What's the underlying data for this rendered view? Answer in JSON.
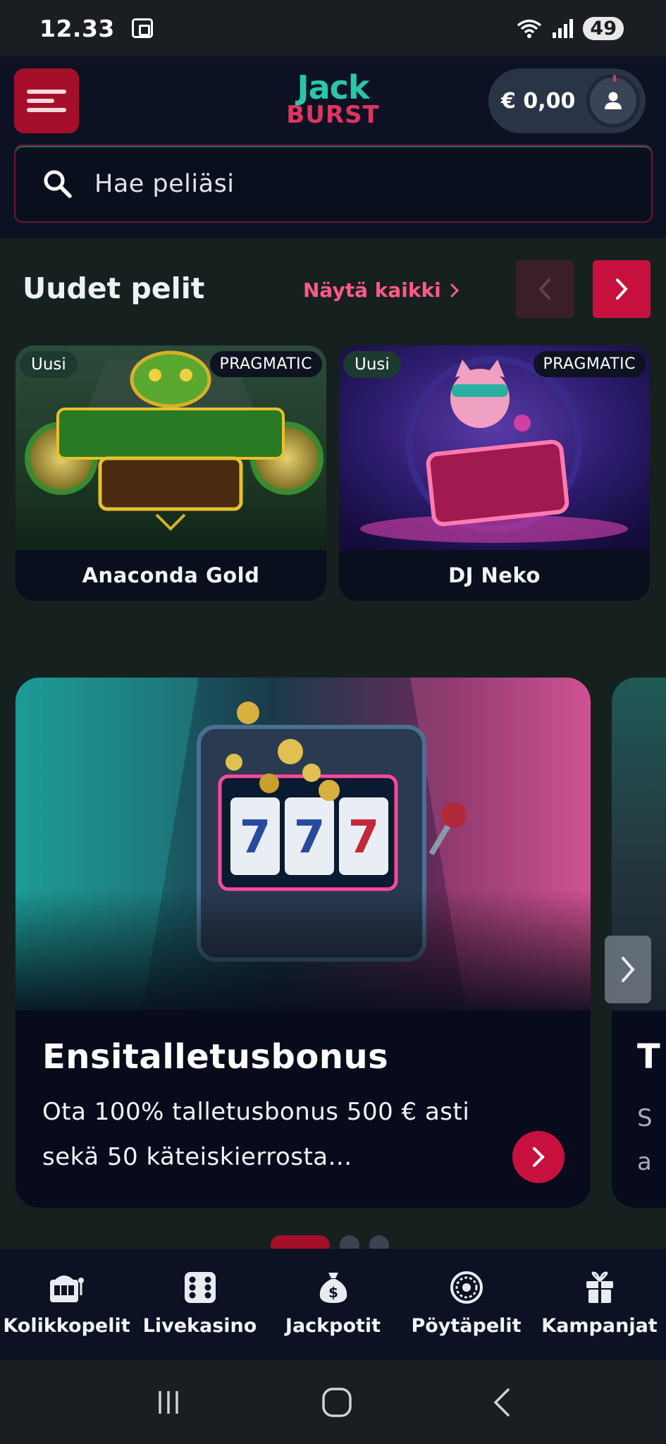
{
  "status_bar": {
    "time": "12.33",
    "battery": "49"
  },
  "header": {
    "logo_line1": "Jack",
    "logo_line2": "BURST",
    "balance": "€ 0,00",
    "search_placeholder": "Hae peliäsi"
  },
  "new_games": {
    "title": "Uudet pelit",
    "show_all": "Näytä kaikki",
    "games": [
      {
        "name": "Anaconda Gold",
        "badge": "Uusi",
        "provider": "PRAGMATIC"
      },
      {
        "name": "DJ Neko",
        "badge": "Uusi",
        "provider": "PRAGMATIC"
      }
    ]
  },
  "promo": {
    "title": "Ensitalletusbonus",
    "description": "Ota 100% talletusbonus 500 € asti sekä 50 käteiskierrosta...",
    "next_card": {
      "title_fragment": "T",
      "desc_fragment_1": "S",
      "desc_fragment_2": "a"
    }
  },
  "bottom_nav": {
    "items": [
      {
        "label": "Kolikkopelit",
        "icon": "slot-machine-icon"
      },
      {
        "label": "Livekasino",
        "icon": "dice-icon"
      },
      {
        "label": "Jackpotit",
        "icon": "money-bag-icon"
      },
      {
        "label": "Pöytäpelit",
        "icon": "roulette-icon"
      },
      {
        "label": "Kampanjat",
        "icon": "gift-icon"
      }
    ]
  }
}
